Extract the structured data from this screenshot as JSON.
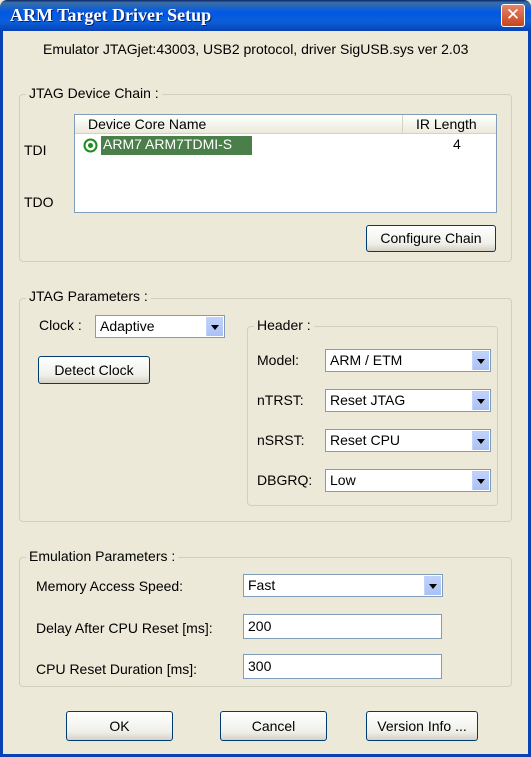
{
  "window": {
    "title": "ARM Target Driver Setup"
  },
  "emulator_info": "Emulator JTAGjet:43003, USB2 protocol, driver SigUSB.sys ver 2.03",
  "chain": {
    "legend": "JTAG Device Chain :",
    "tdi_label": "TDI",
    "tdo_label": "TDO",
    "columns": [
      "Device Core Name",
      "IR Length"
    ],
    "rows": [
      {
        "name": "ARM7 ARM7TDMI-S",
        "ir_length": "4"
      }
    ],
    "configure_button": "Configure Chain"
  },
  "jtag_params": {
    "legend": "JTAG Parameters :",
    "clock_label": "Clock :",
    "clock_value": "Adaptive",
    "detect_clock_button": "Detect Clock",
    "header": {
      "legend": "Header :",
      "model_label": "Model:",
      "model_value": "ARM / ETM",
      "ntrst_label": "nTRST:",
      "ntrst_value": "Reset JTAG",
      "nsrst_label": "nSRST:",
      "nsrst_value": "Reset CPU",
      "dbgrq_label": "DBGRQ:",
      "dbgrq_value": "Low"
    }
  },
  "emulation": {
    "legend": "Emulation Parameters :",
    "mem_speed_label": "Memory Access Speed:",
    "mem_speed_value": "Fast",
    "delay_label": "Delay After CPU Reset [ms]:",
    "delay_value": "200",
    "duration_label": "CPU Reset Duration [ms]:",
    "duration_value": "300"
  },
  "buttons": {
    "ok": "OK",
    "cancel": "Cancel",
    "version": "Version Info ..."
  },
  "colors": {
    "title_bar": "#0058E6",
    "dialog_bg": "#ECE9D8",
    "selection": "#4A7F4A",
    "device_icon": "#1E8C1E"
  }
}
